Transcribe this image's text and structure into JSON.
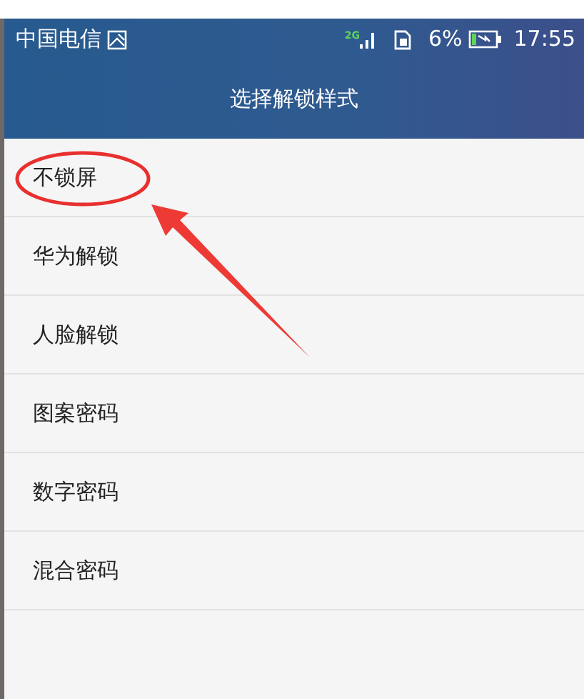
{
  "status_bar": {
    "carrier": "中国电信",
    "network": "2G",
    "battery_percent": "6%",
    "battery_charging": true,
    "time": "17:55"
  },
  "header": {
    "title": "选择解锁样式"
  },
  "options": [
    {
      "label": "不锁屏",
      "circled": true
    },
    {
      "label": "华为解锁",
      "circled": false
    },
    {
      "label": "人脸解锁",
      "circled": false
    },
    {
      "label": "图案密码",
      "circled": false
    },
    {
      "label": "数字密码",
      "circled": false
    },
    {
      "label": "混合密码",
      "circled": false
    }
  ]
}
